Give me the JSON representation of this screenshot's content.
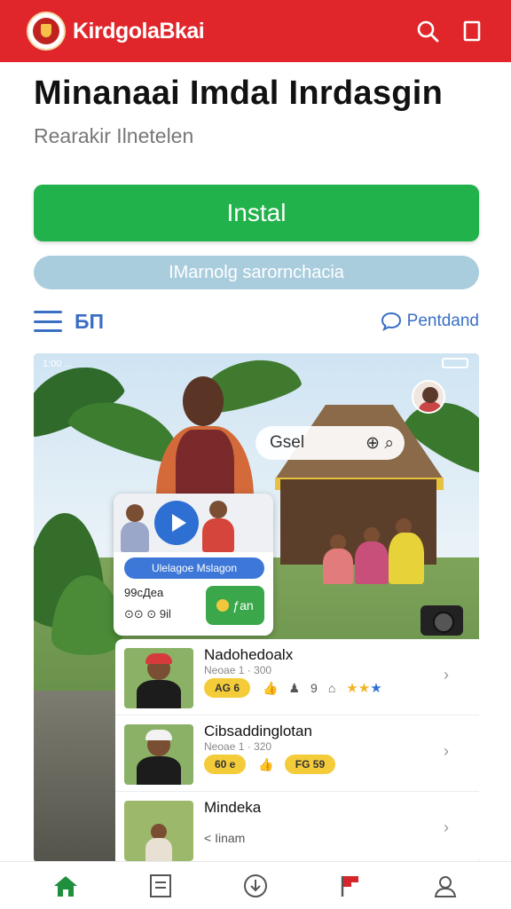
{
  "app_bar": {
    "brand": "KirdgolaΒkai",
    "logo_icon": "crest-logo-icon",
    "search_icon": "search-icon",
    "menu_icon": "square-icon",
    "color": "#e0262b"
  },
  "header": {
    "title": "Minanaai Imdal Inrdasgin",
    "subtitle": "Rearakir Ilnetelen"
  },
  "actions": {
    "install_label": "Instal",
    "install_color": "#22b24b",
    "info_pill": "IMarnolg sarornchacia"
  },
  "toolbar": {
    "language": "БП",
    "share_label": "Pentdand"
  },
  "media": {
    "status_left": "1:00 ... ",
    "search_chip": {
      "text": "Gsel",
      "icons": "⊕ ⌕"
    },
    "video_card": {
      "pill_label": "Ulelagoe Mslagon",
      "meta": "99cДea",
      "stats": "⊙⊙ ⊙ 9il",
      "button_label": "ƒan"
    }
  },
  "list": [
    {
      "title": "Nadohedoalx",
      "subtitle": "Neoae 1 · 300",
      "badge": "AG 6",
      "trailing": "9",
      "stars": "★★",
      "star_blue": "★"
    },
    {
      "title": "Cibsaddinglotan",
      "subtitle": "Neoae 1 · 320",
      "badge": "60 e",
      "trailing": "",
      "badge2": "FG 59"
    },
    {
      "title": "Mindeka",
      "subtitle": "",
      "action": "< Iinam"
    }
  ],
  "bottom_nav": {
    "items": [
      "home-icon",
      "list-icon",
      "download-icon",
      "flag-icon",
      "profile-icon"
    ]
  }
}
